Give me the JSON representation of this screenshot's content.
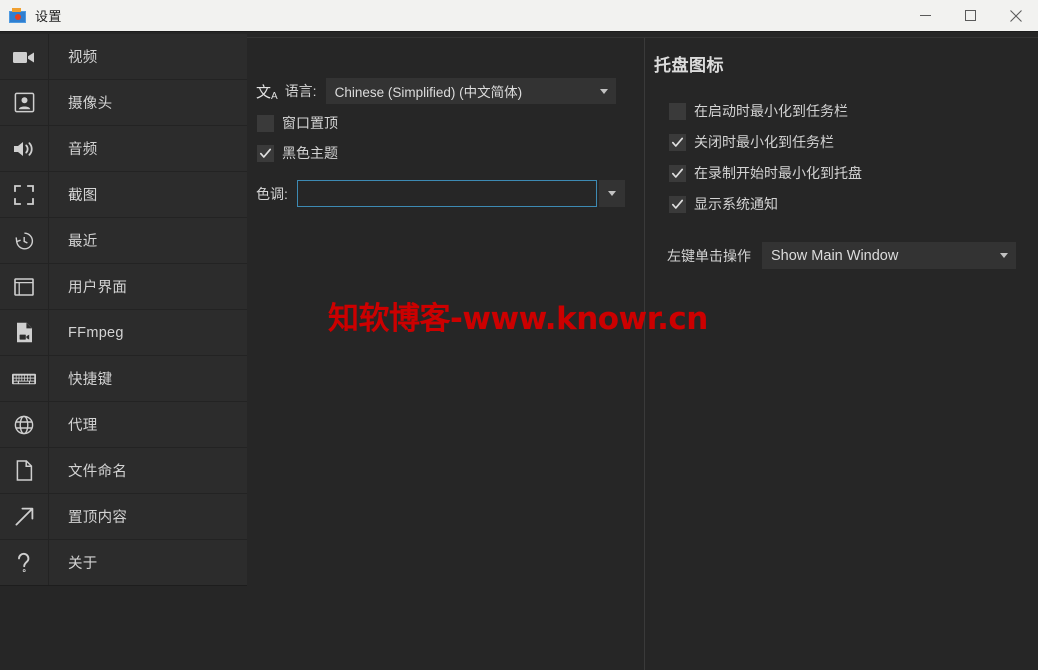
{
  "window": {
    "title": "设置",
    "icon": "camera-app-icon",
    "controls": {
      "minimize": "minimize-icon",
      "maximize": "maximize-icon",
      "close": "close-icon"
    }
  },
  "sidebar": {
    "items": [
      {
        "label": "视频",
        "icon": "video-camera-icon"
      },
      {
        "label": "摄像头",
        "icon": "webcam-icon"
      },
      {
        "label": "音频",
        "icon": "speaker-icon"
      },
      {
        "label": "截图",
        "icon": "screenshot-frame-icon"
      },
      {
        "label": "最近",
        "icon": "history-clock-icon"
      },
      {
        "label": "用户界面",
        "icon": "window-layout-icon"
      },
      {
        "label": "FFmpeg",
        "icon": "file-video-icon"
      },
      {
        "label": "快捷键",
        "icon": "keyboard-icon"
      },
      {
        "label": "代理",
        "icon": "globe-icon"
      },
      {
        "label": "文件命名",
        "icon": "file-document-icon"
      },
      {
        "label": "置顶内容",
        "icon": "arrow-up-right-icon"
      },
      {
        "label": "关于",
        "icon": "question-mark-icon"
      }
    ]
  },
  "ui_panel": {
    "language": {
      "icon": "translate-icon",
      "icon_glyph": "文",
      "icon_sub": "A",
      "label": "语言:",
      "value": "Chinese (Simplified) (中文简体)"
    },
    "checkboxes": [
      {
        "label": "窗口置顶",
        "checked": false
      },
      {
        "label": "黑色主题",
        "checked": true
      }
    ],
    "tint": {
      "label": "色调:",
      "color": "#1f9ad6"
    }
  },
  "tray_panel": {
    "title": "托盘图标",
    "checkboxes": [
      {
        "label": "在启动时最小化到任务栏",
        "checked": false
      },
      {
        "label": "关闭时最小化到任务栏",
        "checked": true
      },
      {
        "label": "在录制开始时最小化到托盘",
        "checked": true
      },
      {
        "label": "显示系统通知",
        "checked": true
      }
    ],
    "click_action": {
      "label": "左键单击操作",
      "value": "Show Main Window"
    }
  },
  "watermark": {
    "text": "知软博客-www.knowr.cn",
    "color": "#cc0000"
  },
  "theme": {
    "titlebar_bg": "#f2f2f0",
    "content_bg": "#262626",
    "sidebar_bg": "#2c2c2c",
    "control_bg": "#333333",
    "text": "#d3d3d3",
    "accent": "#1f9ad6"
  }
}
